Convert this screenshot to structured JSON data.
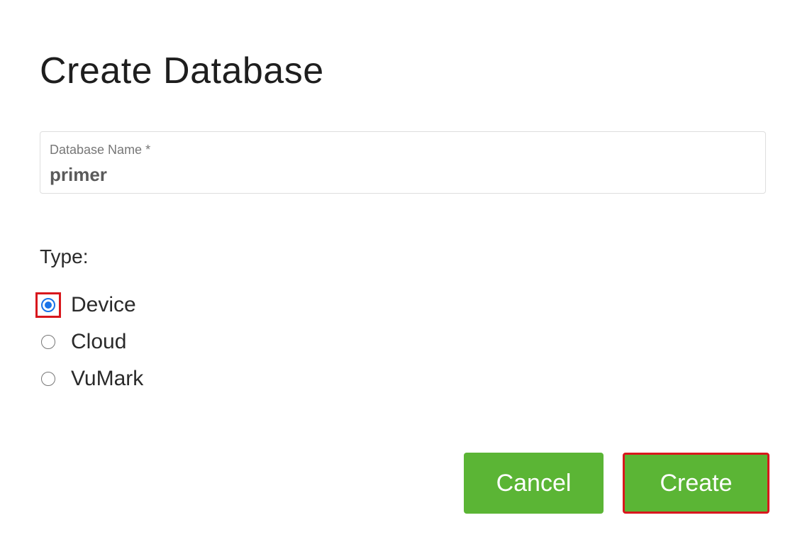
{
  "dialog": {
    "title": "Create Database"
  },
  "name_field": {
    "label": "Database Name *",
    "value": "primer"
  },
  "type_group": {
    "label": "Type:",
    "options": [
      {
        "label": "Device",
        "checked": true
      },
      {
        "label": "Cloud",
        "checked": false
      },
      {
        "label": "VuMark",
        "checked": false
      }
    ]
  },
  "buttons": {
    "cancel_label": "Cancel",
    "create_label": "Create"
  },
  "colors": {
    "button_green": "#5bb535",
    "radio_selected_blue": "#1a73e8",
    "highlight_red": "#d8171d"
  }
}
